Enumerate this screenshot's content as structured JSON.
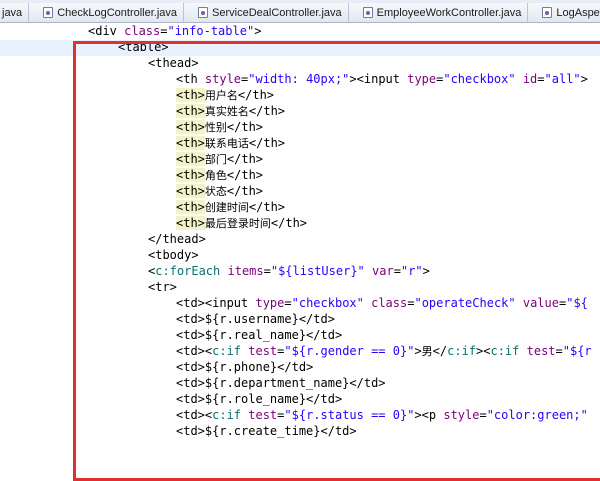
{
  "tabs": [
    {
      "label": "java",
      "icon": "java-file-icon"
    },
    {
      "label": "CheckLogController.java",
      "icon": "java-file-icon"
    },
    {
      "label": "ServiceDealController.java",
      "icon": "java-file-icon"
    },
    {
      "label": "EmployeeWorkController.java",
      "icon": "java-file-icon"
    },
    {
      "label": "LogAspect.java",
      "icon": "java-file-icon"
    }
  ],
  "code": {
    "l0": {
      "open": "<div ",
      "attr": "class",
      "eq": "=",
      "val": "\"info-table\"",
      "close": ">"
    },
    "l1": {
      "text": "<table>"
    },
    "l2": {
      "text": "<thead>"
    },
    "l3": {
      "a": "<th ",
      "attr1": "style",
      "eq1": "=",
      "val1": "\"width: 40px;\"",
      "b": "><input ",
      "attr2": "type",
      "eq2": "=",
      "val2": "\"checkbox\"",
      "attr3": " id",
      "eq3": "=",
      "val3": "\"all\"",
      "c": ">"
    },
    "th": [
      {
        "open": "<th>",
        "text": "用户名",
        "close": "</th>"
      },
      {
        "open": "<th>",
        "text": "真实姓名",
        "close": "</th>"
      },
      {
        "open": "<th>",
        "text": "性别",
        "close": "</th>"
      },
      {
        "open": "<th>",
        "text": "联系电话",
        "close": "</th>"
      },
      {
        "open": "<th>",
        "text": "部门",
        "close": "</th>"
      },
      {
        "open": "<th>",
        "text": "角色",
        "close": "</th>"
      },
      {
        "open": "<th>",
        "text": "状态",
        "close": "</th>"
      },
      {
        "open": "<th>",
        "text": "创建时间",
        "close": "</th>"
      },
      {
        "open": "<th>",
        "text": "最后登录时间",
        "close": "</th>"
      }
    ],
    "l13": {
      "text": "</thead>"
    },
    "l14": {
      "text": "<tbody>"
    },
    "l15": {
      "open": "<",
      "tag": "c:forEach",
      "attr1": " items",
      "eq1": "=",
      "val1": "\"${listUser}\"",
      "attr2": " var",
      "eq2": "=",
      "val2": "\"r\"",
      "close": ">"
    },
    "l16": {
      "text": "<tr>"
    },
    "l17": {
      "a": "<td><input ",
      "attr1": "type",
      "eq1": "=",
      "val1": "\"checkbox\"",
      "attr2": " class",
      "eq2": "=",
      "val2": "\"operateCheck\"",
      "attr3": " value",
      "eq3": "=",
      "val3": "\"${"
    },
    "l18": {
      "text": "<td>${r.username}</td>"
    },
    "l19": {
      "text": "<td>${r.real_name}</td>"
    },
    "l20": {
      "a": "<td><",
      "tag1": "c:if",
      "attr1": " test",
      "eq1": "=",
      "val1": "\"${r.gender == 0}\"",
      "b": ">",
      "cn": "男",
      "c": "</",
      "tag2": "c:if",
      "d": "><",
      "tag3": "c:if",
      "attr2": " test",
      "eq2": "=",
      "val2": "\"${r"
    },
    "l21": {
      "text": "<td>${r.phone}</td>"
    },
    "l22": {
      "text": "<td>${r.department_name}</td>"
    },
    "l23": {
      "text": "<td>${r.role_name}</td>"
    },
    "l24": {
      "a": "<td><",
      "tag1": "c:if",
      "attr1": " test",
      "eq1": "=",
      "val1": "\"${r.status == 0}\"",
      "b": "><p ",
      "attr2": "style",
      "eq2": "=",
      "val2": "\"color:green;\""
    },
    "l25": {
      "text": "<td>${r.create_time}</td>"
    }
  },
  "colors": {
    "highlight_box": "#e0312f",
    "attr": "#7a007a",
    "value": "#2a00ff",
    "jstl_tag": "#0a6f74"
  }
}
